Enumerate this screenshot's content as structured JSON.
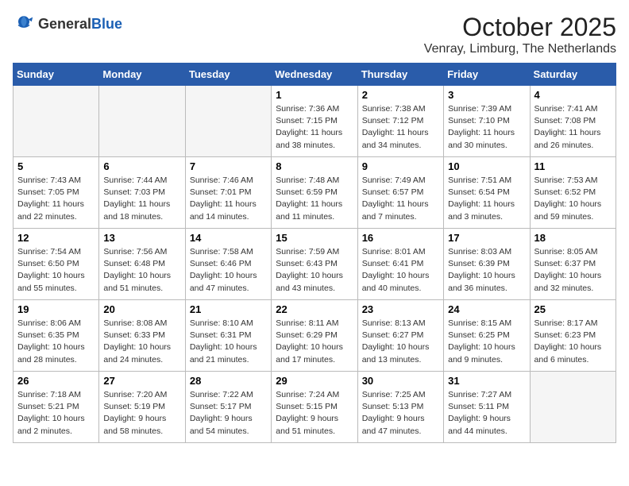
{
  "header": {
    "logo_general": "General",
    "logo_blue": "Blue",
    "month": "October 2025",
    "location": "Venray, Limburg, The Netherlands"
  },
  "days_of_week": [
    "Sunday",
    "Monday",
    "Tuesday",
    "Wednesday",
    "Thursday",
    "Friday",
    "Saturday"
  ],
  "weeks": [
    [
      {
        "day": "",
        "info": ""
      },
      {
        "day": "",
        "info": ""
      },
      {
        "day": "",
        "info": ""
      },
      {
        "day": "1",
        "info": "Sunrise: 7:36 AM\nSunset: 7:15 PM\nDaylight: 11 hours\nand 38 minutes."
      },
      {
        "day": "2",
        "info": "Sunrise: 7:38 AM\nSunset: 7:12 PM\nDaylight: 11 hours\nand 34 minutes."
      },
      {
        "day": "3",
        "info": "Sunrise: 7:39 AM\nSunset: 7:10 PM\nDaylight: 11 hours\nand 30 minutes."
      },
      {
        "day": "4",
        "info": "Sunrise: 7:41 AM\nSunset: 7:08 PM\nDaylight: 11 hours\nand 26 minutes."
      }
    ],
    [
      {
        "day": "5",
        "info": "Sunrise: 7:43 AM\nSunset: 7:05 PM\nDaylight: 11 hours\nand 22 minutes."
      },
      {
        "day": "6",
        "info": "Sunrise: 7:44 AM\nSunset: 7:03 PM\nDaylight: 11 hours\nand 18 minutes."
      },
      {
        "day": "7",
        "info": "Sunrise: 7:46 AM\nSunset: 7:01 PM\nDaylight: 11 hours\nand 14 minutes."
      },
      {
        "day": "8",
        "info": "Sunrise: 7:48 AM\nSunset: 6:59 PM\nDaylight: 11 hours\nand 11 minutes."
      },
      {
        "day": "9",
        "info": "Sunrise: 7:49 AM\nSunset: 6:57 PM\nDaylight: 11 hours\nand 7 minutes."
      },
      {
        "day": "10",
        "info": "Sunrise: 7:51 AM\nSunset: 6:54 PM\nDaylight: 11 hours\nand 3 minutes."
      },
      {
        "day": "11",
        "info": "Sunrise: 7:53 AM\nSunset: 6:52 PM\nDaylight: 10 hours\nand 59 minutes."
      }
    ],
    [
      {
        "day": "12",
        "info": "Sunrise: 7:54 AM\nSunset: 6:50 PM\nDaylight: 10 hours\nand 55 minutes."
      },
      {
        "day": "13",
        "info": "Sunrise: 7:56 AM\nSunset: 6:48 PM\nDaylight: 10 hours\nand 51 minutes."
      },
      {
        "day": "14",
        "info": "Sunrise: 7:58 AM\nSunset: 6:46 PM\nDaylight: 10 hours\nand 47 minutes."
      },
      {
        "day": "15",
        "info": "Sunrise: 7:59 AM\nSunset: 6:43 PM\nDaylight: 10 hours\nand 43 minutes."
      },
      {
        "day": "16",
        "info": "Sunrise: 8:01 AM\nSunset: 6:41 PM\nDaylight: 10 hours\nand 40 minutes."
      },
      {
        "day": "17",
        "info": "Sunrise: 8:03 AM\nSunset: 6:39 PM\nDaylight: 10 hours\nand 36 minutes."
      },
      {
        "day": "18",
        "info": "Sunrise: 8:05 AM\nSunset: 6:37 PM\nDaylight: 10 hours\nand 32 minutes."
      }
    ],
    [
      {
        "day": "19",
        "info": "Sunrise: 8:06 AM\nSunset: 6:35 PM\nDaylight: 10 hours\nand 28 minutes."
      },
      {
        "day": "20",
        "info": "Sunrise: 8:08 AM\nSunset: 6:33 PM\nDaylight: 10 hours\nand 24 minutes."
      },
      {
        "day": "21",
        "info": "Sunrise: 8:10 AM\nSunset: 6:31 PM\nDaylight: 10 hours\nand 21 minutes."
      },
      {
        "day": "22",
        "info": "Sunrise: 8:11 AM\nSunset: 6:29 PM\nDaylight: 10 hours\nand 17 minutes."
      },
      {
        "day": "23",
        "info": "Sunrise: 8:13 AM\nSunset: 6:27 PM\nDaylight: 10 hours\nand 13 minutes."
      },
      {
        "day": "24",
        "info": "Sunrise: 8:15 AM\nSunset: 6:25 PM\nDaylight: 10 hours\nand 9 minutes."
      },
      {
        "day": "25",
        "info": "Sunrise: 8:17 AM\nSunset: 6:23 PM\nDaylight: 10 hours\nand 6 minutes."
      }
    ],
    [
      {
        "day": "26",
        "info": "Sunrise: 7:18 AM\nSunset: 5:21 PM\nDaylight: 10 hours\nand 2 minutes."
      },
      {
        "day": "27",
        "info": "Sunrise: 7:20 AM\nSunset: 5:19 PM\nDaylight: 9 hours\nand 58 minutes."
      },
      {
        "day": "28",
        "info": "Sunrise: 7:22 AM\nSunset: 5:17 PM\nDaylight: 9 hours\nand 54 minutes."
      },
      {
        "day": "29",
        "info": "Sunrise: 7:24 AM\nSunset: 5:15 PM\nDaylight: 9 hours\nand 51 minutes."
      },
      {
        "day": "30",
        "info": "Sunrise: 7:25 AM\nSunset: 5:13 PM\nDaylight: 9 hours\nand 47 minutes."
      },
      {
        "day": "31",
        "info": "Sunrise: 7:27 AM\nSunset: 5:11 PM\nDaylight: 9 hours\nand 44 minutes."
      },
      {
        "day": "",
        "info": ""
      }
    ]
  ]
}
